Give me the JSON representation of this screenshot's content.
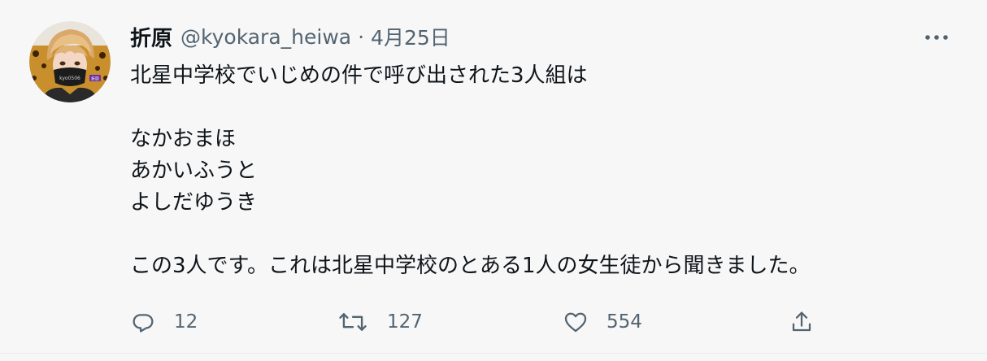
{
  "tweet": {
    "author_name": "折原",
    "handle": "@kyokara_heiwa",
    "separator": "·",
    "date": "4月25日",
    "lines": [
      "北星中学校でいじめの件で呼び出された3人組は",
      "",
      "なかおまほ",
      "あかいふうと",
      "よしだゆうき",
      "",
      "この3人です。これは北星中学校のとある1人の女生徒から聞きました。"
    ],
    "avatar_text": "kyo0506",
    "avatar_badge": "折原",
    "reply_count": "12",
    "retweet_count": "127",
    "like_count": "554"
  },
  "icons": {
    "more": "more-horizontal-icon",
    "reply": "reply-icon",
    "retweet": "retweet-icon",
    "like": "heart-icon",
    "share": "share-icon"
  },
  "colors": {
    "text": "#0f1419",
    "muted": "#536471",
    "background": "#f7f7f7"
  }
}
